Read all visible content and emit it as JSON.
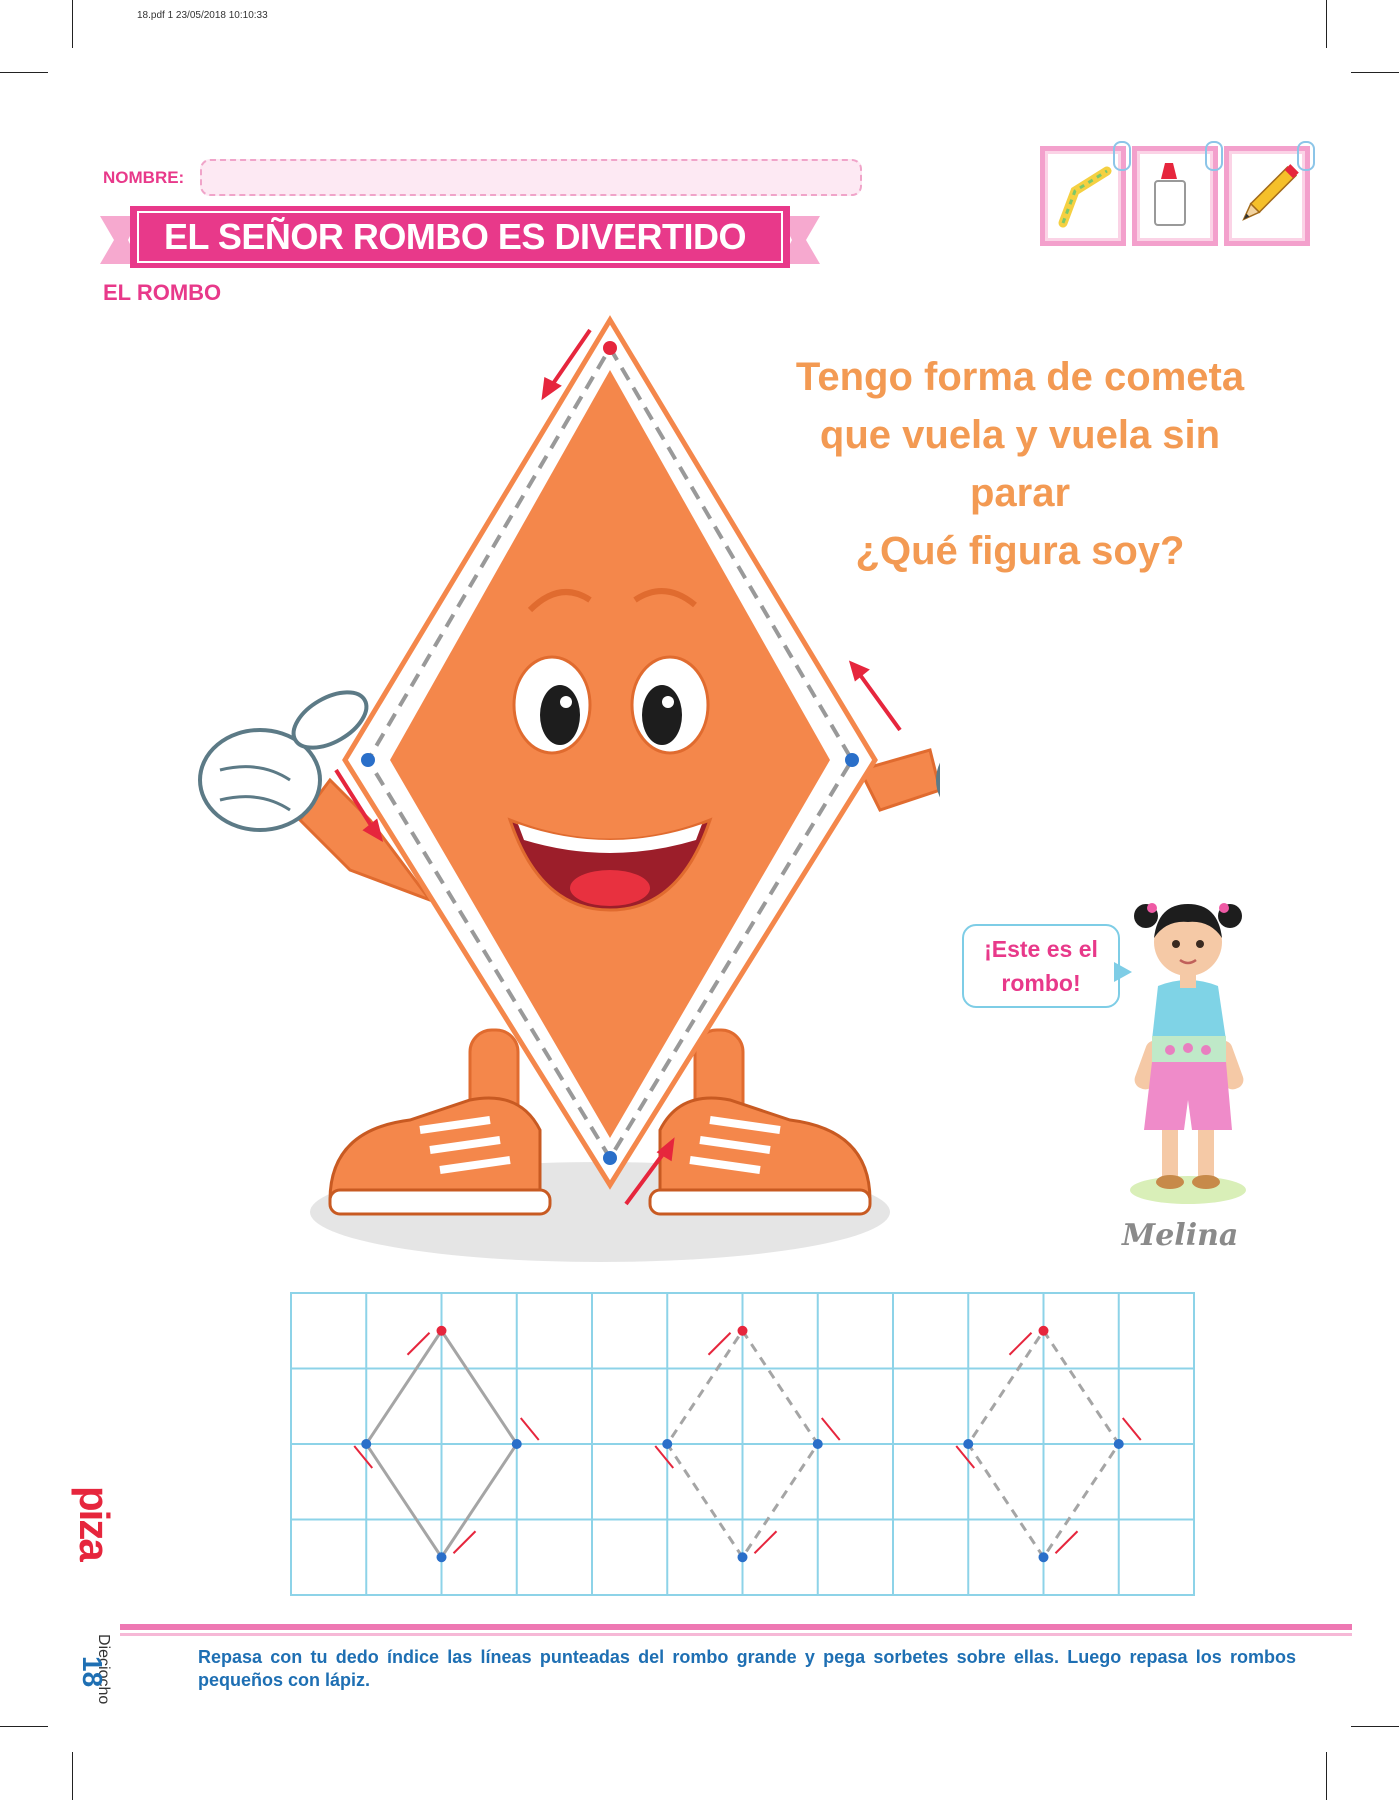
{
  "print_header": "18.pdf   1   23/05/2018   10:10:33",
  "worksheet": {
    "name_label": "NOMBRE:",
    "title": "EL SEÑOR ROMBO ES DIVERTIDO",
    "subtitle": "EL ROMBO"
  },
  "materials": [
    {
      "icon": "straw-icon"
    },
    {
      "icon": "glue-icon"
    },
    {
      "icon": "pencil-icon"
    }
  ],
  "riddle": {
    "lines": [
      "Tengo forma de cometa",
      "que vuela y vuela sin",
      "parar",
      "¿Qué figura soy?"
    ]
  },
  "speech_bubble": {
    "lines": [
      "¡Este es el",
      "rombo!"
    ]
  },
  "girl_name": "Melina",
  "instructions": "Repasa con tu dedo índice las líneas punteadas del rombo grande y pega sorbetes sobre ellas. Luego repasa los rombos pequeños con lápiz.",
  "page": {
    "number": "18",
    "word": "Dieciocho"
  },
  "publisher": "piza",
  "colors": {
    "pink": "#e8398a",
    "orange_text": "#f39a53",
    "rhombus_orange": "#f4874b",
    "grid_blue": "#8dd3e8",
    "dot_red": "#e6263d",
    "dot_blue": "#2a6fc9",
    "instruction_blue": "#1e6fb3"
  }
}
